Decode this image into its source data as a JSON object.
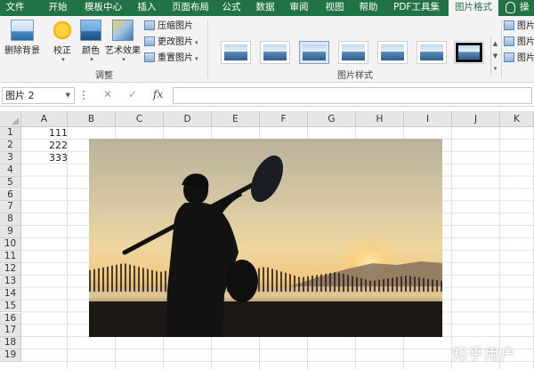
{
  "ribbon_tabs": [
    {
      "label": "文件"
    },
    {
      "label": "开始"
    },
    {
      "label": "模板中心"
    },
    {
      "label": "插入"
    },
    {
      "label": "页面布局"
    },
    {
      "label": "公式"
    },
    {
      "label": "数据"
    },
    {
      "label": "审阅"
    },
    {
      "label": "视图"
    },
    {
      "label": "帮助"
    },
    {
      "label": "PDF工具集"
    },
    {
      "label": "图片格式"
    }
  ],
  "tab_overflow_label": "操",
  "ribbon": {
    "remove_bg": "删除背景",
    "corrections": "校正",
    "color": "颜色",
    "artistic": "艺术效果",
    "compress": "压缩图片",
    "change": "更改图片",
    "reset": "重置图片",
    "adjust_group": "调整",
    "styles_group": "图片样式",
    "right_items": [
      "图片",
      "图片",
      "图片"
    ]
  },
  "formula_bar": {
    "name_box": "图片 2",
    "fx_label": "fx",
    "value": ""
  },
  "columns": [
    "A",
    "B",
    "C",
    "D",
    "E",
    "F",
    "G",
    "H",
    "I",
    "J",
    "K"
  ],
  "rows": [
    "1",
    "2",
    "3",
    "4",
    "5",
    "6",
    "7",
    "8",
    "9",
    "10",
    "11",
    "12",
    "13",
    "14",
    "15",
    "16",
    "17",
    "18",
    "19"
  ],
  "cells": {
    "A1": "111",
    "A2": "222",
    "A3": "333"
  },
  "watermark": "知乎用户"
}
